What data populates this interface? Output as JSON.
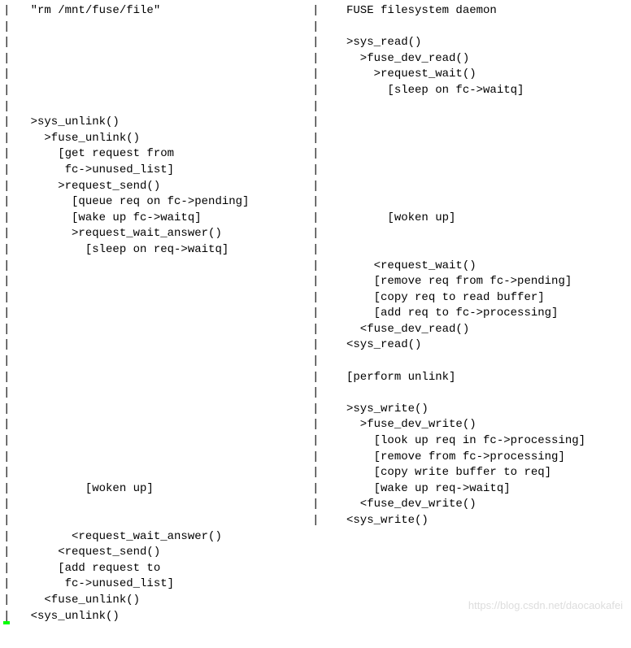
{
  "left": {
    "lines": [
      "|   \"rm /mnt/fuse/file\"",
      "|",
      "|",
      "|",
      "|",
      "|",
      "|",
      "|   >sys_unlink()",
      "|     >fuse_unlink()",
      "|       [get request from",
      "|        fc->unused_list]",
      "|       >request_send()",
      "|         [queue req on fc->pending]",
      "|         [wake up fc->waitq]",
      "|         >request_wait_answer()",
      "|           [sleep on req->waitq]",
      "|",
      "|",
      "|",
      "|",
      "|",
      "|",
      "|",
      "|",
      "|",
      "|",
      "|",
      "|",
      "|",
      "|",
      "|           [woken up]",
      "|",
      "|",
      "|         <request_wait_answer()",
      "|       <request_send()",
      "|       [add request to",
      "|        fc->unused_list]",
      "|     <fuse_unlink()",
      "|   <sys_unlink()"
    ]
  },
  "right": {
    "lines": [
      "|    FUSE filesystem daemon",
      "|",
      "|    >sys_read()",
      "|      >fuse_dev_read()",
      "|        >request_wait()",
      "|          [sleep on fc->waitq]",
      "|",
      "|",
      "|",
      "|",
      "|",
      "|",
      "|",
      "|          [woken up]",
      "|",
      "|",
      "|        <request_wait()",
      "|        [remove req from fc->pending]",
      "|        [copy req to read buffer]",
      "|        [add req to fc->processing]",
      "|      <fuse_dev_read()",
      "|    <sys_read()",
      "|",
      "|    [perform unlink]",
      "|",
      "|    >sys_write()",
      "|      >fuse_dev_write()",
      "|        [look up req in fc->processing]",
      "|        [remove from fc->processing]",
      "|        [copy write buffer to req]",
      "|        [wake up req->waitq]",
      "|      <fuse_dev_write()",
      "|    <sys_write()",
      "",
      "",
      "",
      "",
      "",
      ""
    ]
  },
  "watermark": "https://blog.csdn.net/daocaokafei"
}
